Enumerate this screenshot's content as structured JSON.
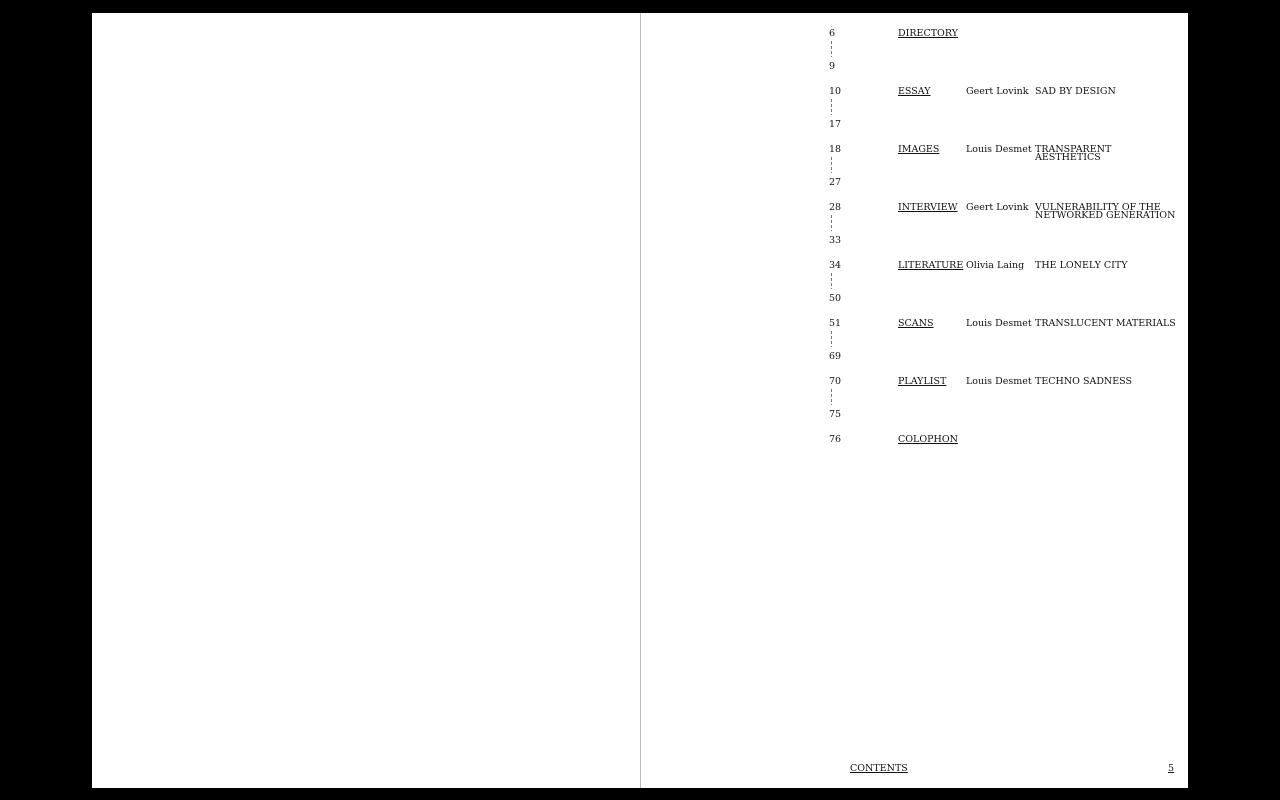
{
  "entries": [
    {
      "start": "6",
      "end": "9",
      "section": "DIRECTORY",
      "author": "",
      "title": ""
    },
    {
      "start": "10",
      "end": "17",
      "section": "ESSAY",
      "author": "Geert Lovink",
      "title": "SAD BY DESIGN"
    },
    {
      "start": "18",
      "end": "27",
      "section": "IMAGES",
      "author": "Louis Desmet",
      "title": "TRANSPARENT AESTHETICS"
    },
    {
      "start": "28",
      "end": "33",
      "section": "INTERVIEW",
      "author": "Geert Lovink",
      "title": "VULNERABILITY OF THE NETWORKED GENERATION"
    },
    {
      "start": "34",
      "end": "50",
      "section": "LITERATURE",
      "author": "Olivia Laing",
      "title": "THE LONELY CITY"
    },
    {
      "start": "51",
      "end": "69",
      "section": "SCANS",
      "author": "Louis Desmet",
      "title": "TRANSLUCENT MATERIALS"
    },
    {
      "start": "70",
      "end": "75",
      "section": "PLAYLIST",
      "author": "Louis Desmet",
      "title": "TECHNO SADNESS"
    },
    {
      "start": "76",
      "end": "",
      "section": "COLOPHON",
      "author": "",
      "title": ""
    }
  ],
  "footer": {
    "label": "CONTENTS",
    "page": "5"
  }
}
